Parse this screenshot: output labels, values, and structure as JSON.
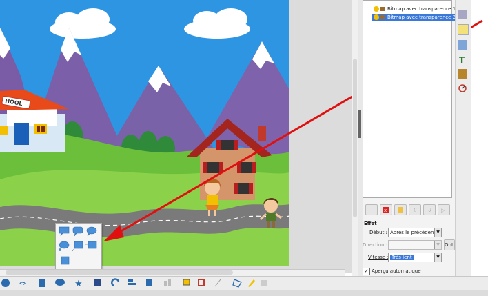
{
  "animation_list": {
    "items": [
      {
        "label": "Bitmap avec transparence 1",
        "selected": false
      },
      {
        "label": "Bitmap avec transparence 2",
        "selected": true
      }
    ]
  },
  "effect": {
    "title": "Effet",
    "debut_label": "Début :",
    "debut_value": "Après le précédent",
    "direction_label": "Direction :",
    "direction_value": "",
    "options_label": "Opt",
    "vitesse_label": "Vitesse :",
    "vitesse_value": "Très lent",
    "apercu_label": "Aperçu automatique",
    "apercu_checked": true
  },
  "slide": {
    "school_sign": "HOOL"
  },
  "colors": {
    "sky": "#2e95e2",
    "grass": "#6cbf3a",
    "road": "#7a7a7a",
    "arrow": "#e01010",
    "selection": "#3b78d8"
  }
}
